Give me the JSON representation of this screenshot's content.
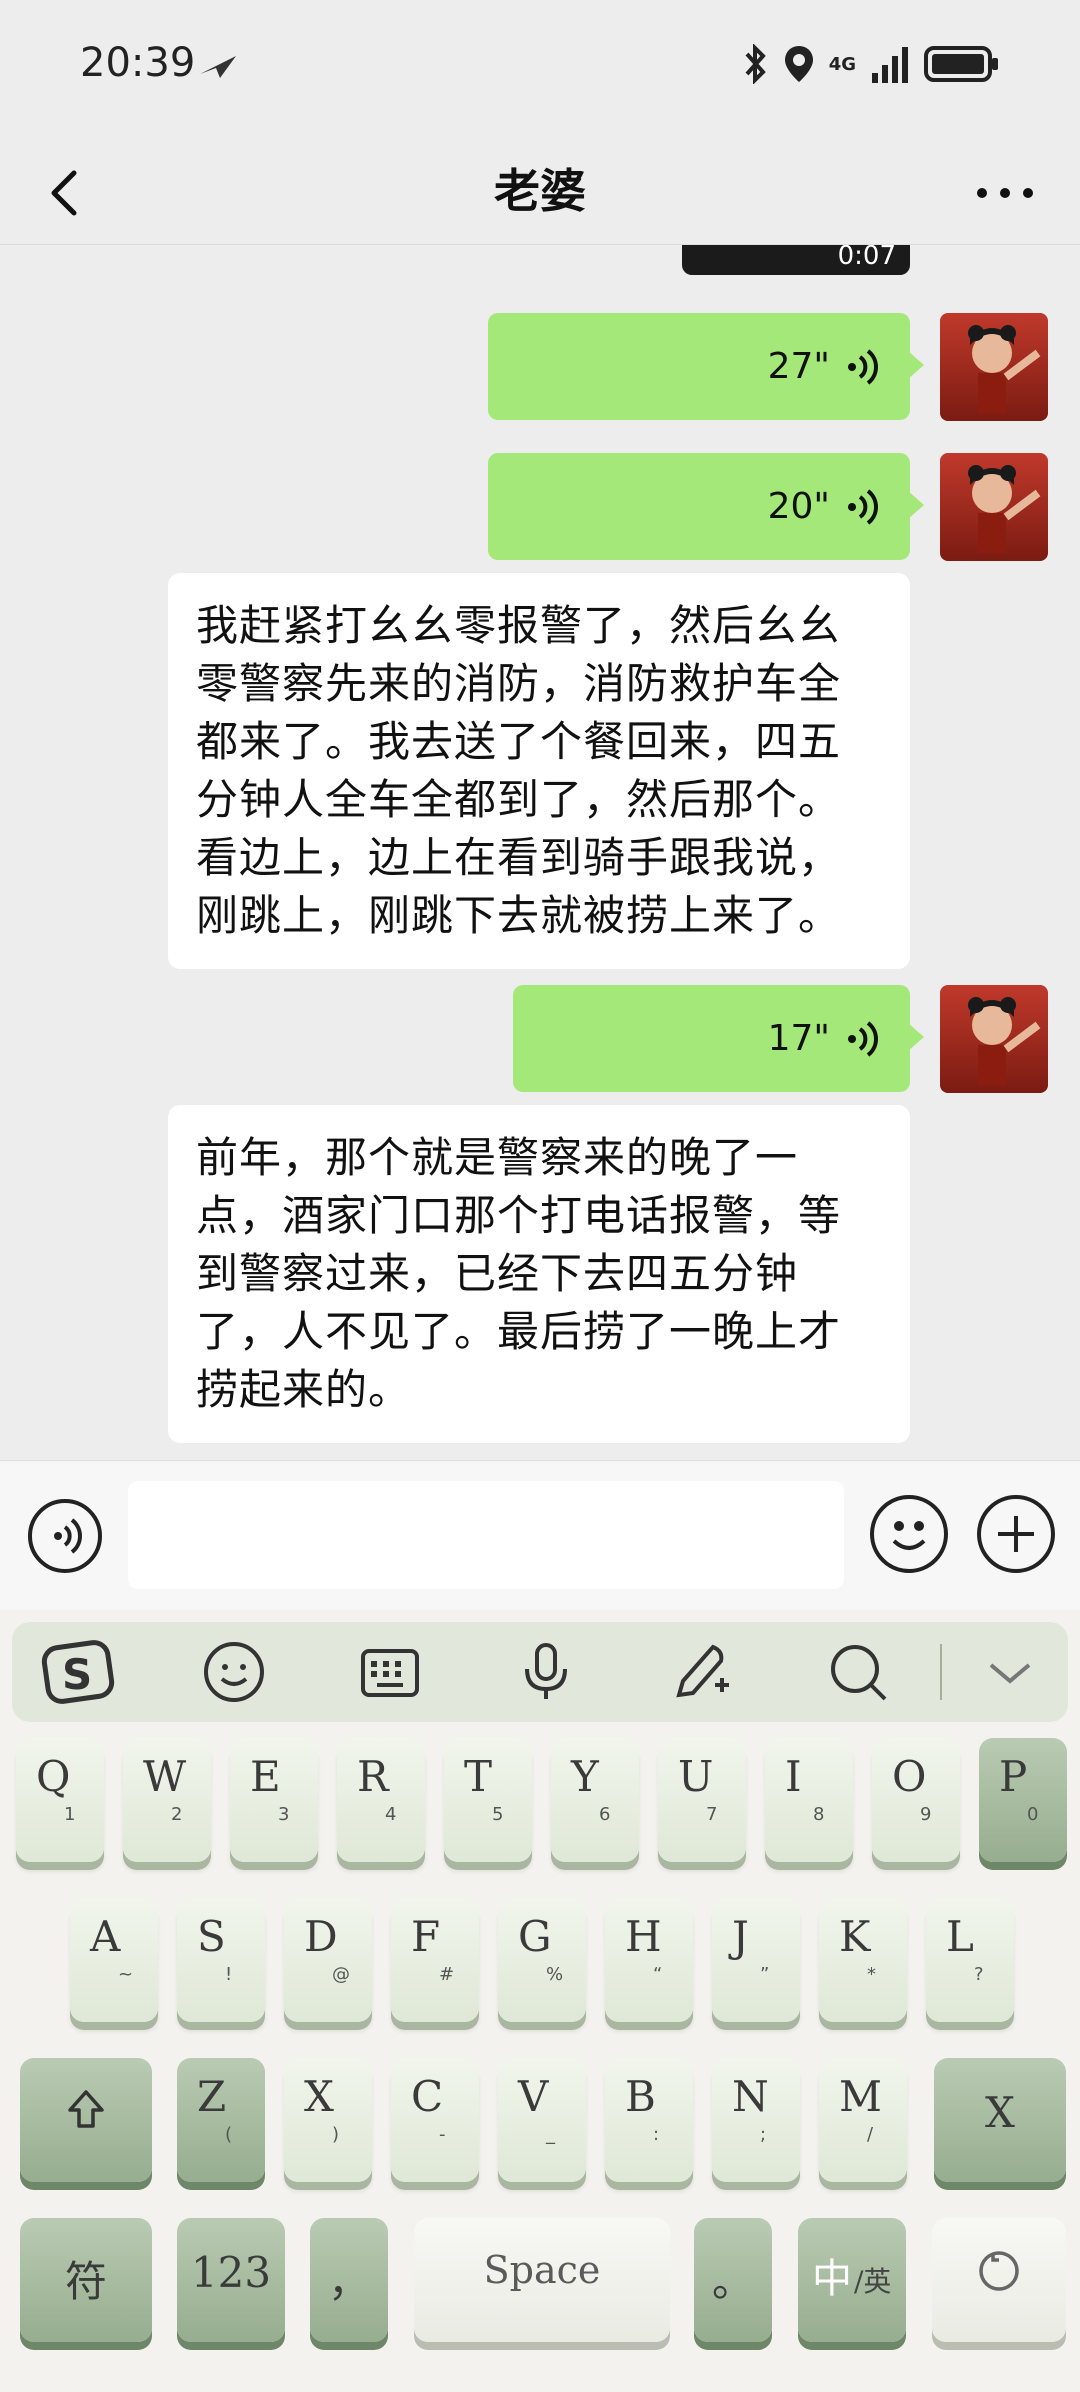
{
  "status_bar": {
    "time": "20:39",
    "network": "4G"
  },
  "header": {
    "title": "老婆"
  },
  "chat": {
    "video_duration": "0:07",
    "messages": [
      {
        "type": "voice",
        "side": "right",
        "duration": "27\""
      },
      {
        "type": "voice",
        "side": "right",
        "duration": "20\""
      },
      {
        "type": "text",
        "side": "left",
        "text": "我赶紧打幺幺零报警了，然后幺幺零警察先来的消防，消防救护车全都来了。我去送了个餐回来，四五分钟人全车全都到了，然后那个。看边上，边上在看到骑手跟我说，刚跳上，刚跳下去就被捞上来了。"
      },
      {
        "type": "voice",
        "side": "right",
        "duration": "17\""
      },
      {
        "type": "text",
        "side": "left",
        "text": "前年，那个就是警察来的晚了一点，酒家门口那个打电话报警，等到警察过来，已经下去四五分钟了，人不见了。最后捞了一晚上才捞起来的。"
      }
    ]
  },
  "keyboard": {
    "toolbar": [
      "sogou-logo-icon",
      "emoji-icon",
      "keyboard-icon",
      "mic-icon",
      "handwriting-icon",
      "search-icon",
      "collapse-icon"
    ],
    "row1": [
      {
        "main": "Q",
        "sub": "1"
      },
      {
        "main": "W",
        "sub": "2"
      },
      {
        "main": "E",
        "sub": "3"
      },
      {
        "main": "R",
        "sub": "4"
      },
      {
        "main": "T",
        "sub": "5"
      },
      {
        "main": "Y",
        "sub": "6"
      },
      {
        "main": "U",
        "sub": "7"
      },
      {
        "main": "I",
        "sub": "8"
      },
      {
        "main": "O",
        "sub": "9"
      },
      {
        "main": "P",
        "sub": "0"
      }
    ],
    "row2": [
      {
        "main": "A",
        "sub": "~"
      },
      {
        "main": "S",
        "sub": "!"
      },
      {
        "main": "D",
        "sub": "@"
      },
      {
        "main": "F",
        "sub": "#"
      },
      {
        "main": "G",
        "sub": "%"
      },
      {
        "main": "H",
        "sub": "“"
      },
      {
        "main": "J",
        "sub": "”"
      },
      {
        "main": "K",
        "sub": "*"
      },
      {
        "main": "L",
        "sub": "?"
      }
    ],
    "row3": [
      {
        "main": "Z",
        "sub": "("
      },
      {
        "main": "X",
        "sub": ")"
      },
      {
        "main": "C",
        "sub": "-"
      },
      {
        "main": "V",
        "sub": "_"
      },
      {
        "main": "B",
        "sub": ":"
      },
      {
        "main": "N",
        "sub": ";"
      },
      {
        "main": "M",
        "sub": "/"
      }
    ],
    "delete_label": "X",
    "symbol_label": "符",
    "num_label": "123",
    "comma_label": "，",
    "space_label": "Space",
    "period_label": "。",
    "lang_label_main": "中",
    "lang_label_sub": "/英"
  }
}
